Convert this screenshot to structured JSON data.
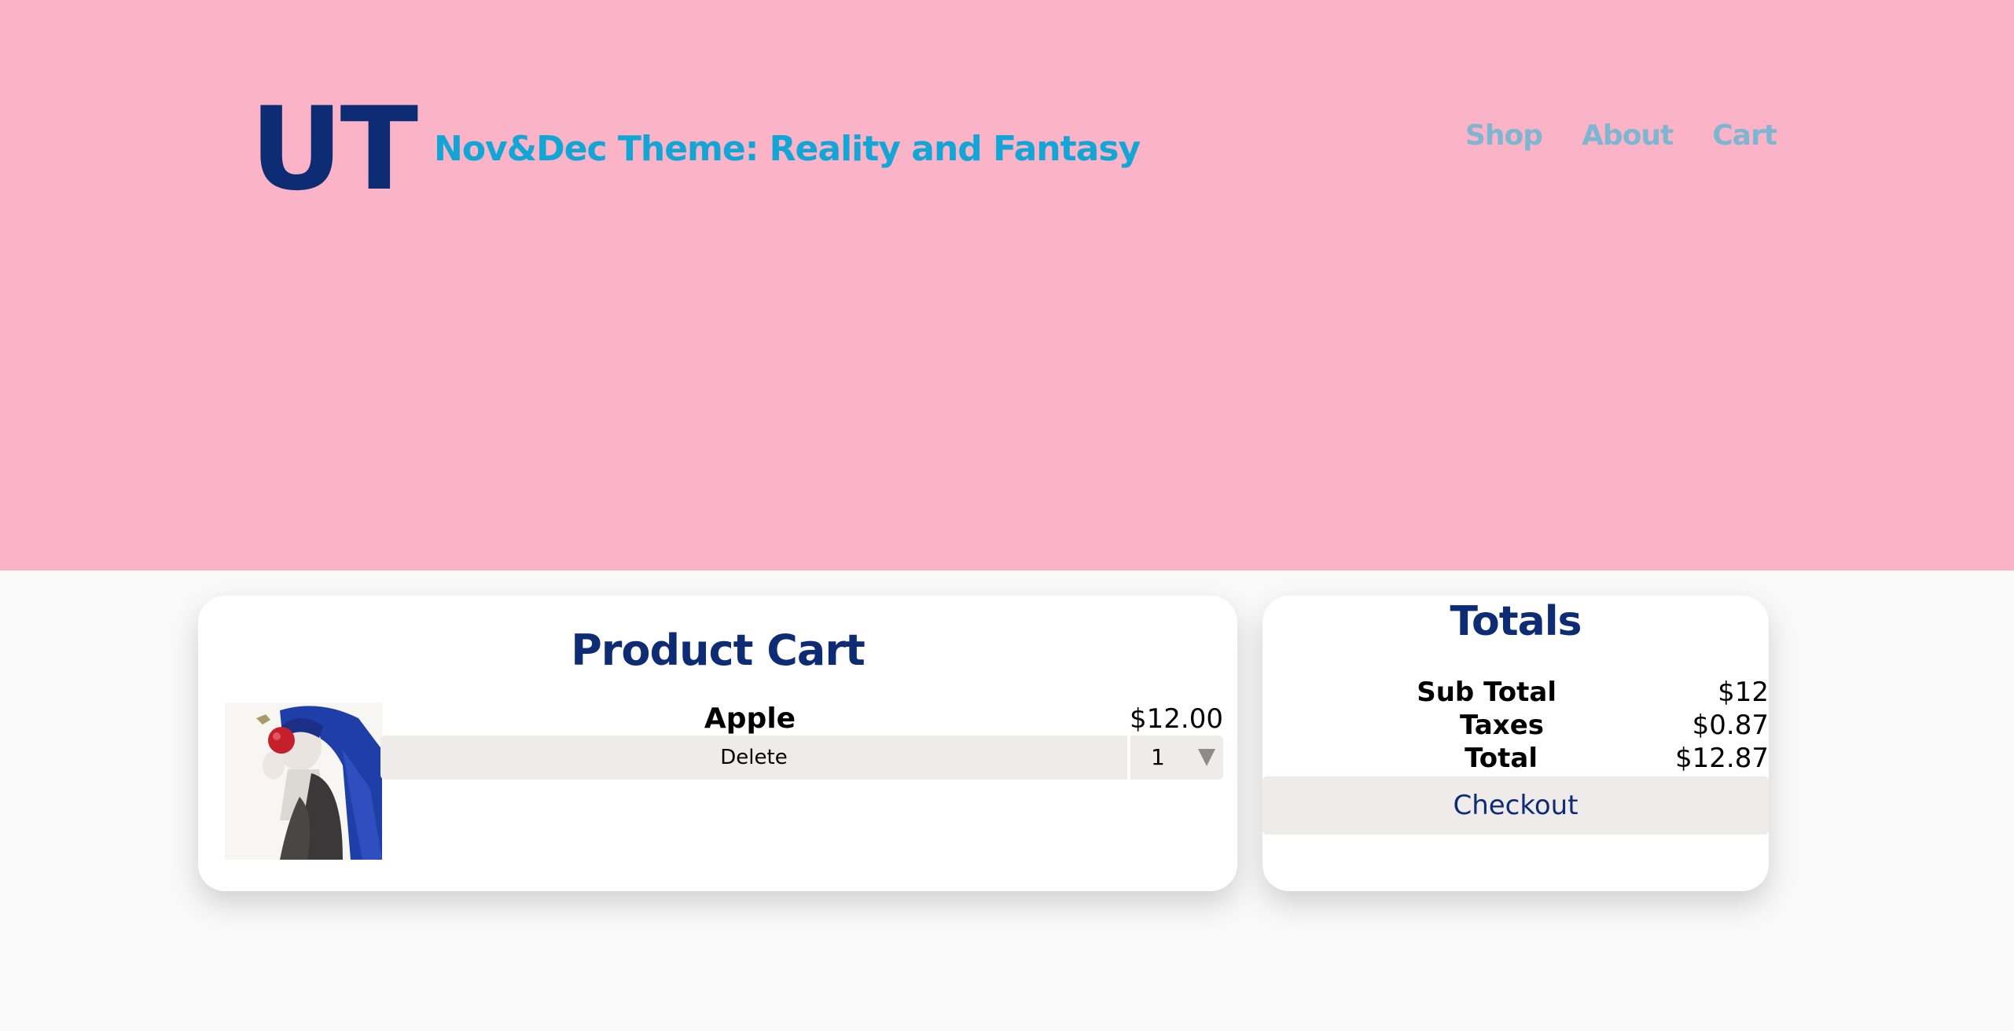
{
  "brand": {
    "logo": "UT",
    "tagline": "Nov&Dec Theme: Reality and Fantasy"
  },
  "nav": {
    "items": [
      {
        "label": "Shop"
      },
      {
        "label": "About"
      },
      {
        "label": "Cart"
      }
    ]
  },
  "cart": {
    "title": "Product Cart",
    "items": [
      {
        "name": "Apple",
        "price": "$12.00",
        "delete_label": "Delete",
        "quantity": "1",
        "image_icon": "product-illustration-girl-with-apple"
      }
    ]
  },
  "totals": {
    "title": "Totals",
    "rows": [
      {
        "label": "Sub Total",
        "value": "$12"
      },
      {
        "label": "Taxes",
        "value": "$0.87"
      },
      {
        "label": "Total",
        "value": "$12.87"
      }
    ],
    "checkout_label": "Checkout"
  },
  "colors": {
    "header_bg": "#fbb3c7",
    "brand_navy": "#0e2c74",
    "tagline_blue": "#12a5d6",
    "nav_link": "#7eb6d1",
    "button_bg": "#efebea",
    "page_bg": "#f9f9f9"
  }
}
